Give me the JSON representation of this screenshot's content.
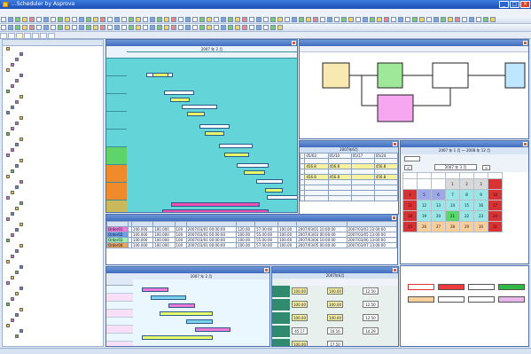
{
  "app": {
    "title": "...Scheduler by Asprova"
  },
  "menu": [
    "",
    "",
    "",
    "",
    "",
    "",
    "",
    "",
    "",
    "",
    "",
    ""
  ],
  "tabs": [
    {
      "label": ""
    },
    {
      "label": ""
    },
    {
      "label": ""
    },
    {
      "label": ""
    },
    {
      "label": ""
    },
    {
      "label": ""
    },
    {
      "label": ""
    }
  ],
  "tree": {
    "header": "",
    "nodes": [
      {
        "label": "",
        "c": "y"
      },
      {
        "label": "",
        "c": "b"
      },
      {
        "label": "",
        "c": "p"
      },
      {
        "label": "",
        "c": "p"
      },
      {
        "label": "",
        "c": "y"
      },
      {
        "label": "",
        "c": "b"
      },
      {
        "label": "",
        "c": "p"
      },
      {
        "label": "",
        "c": "p"
      },
      {
        "label": "",
        "c": "g"
      },
      {
        "label": "",
        "c": "y"
      },
      {
        "label": "",
        "c": "p"
      },
      {
        "label": "",
        "c": "b"
      },
      {
        "label": "",
        "c": "b"
      },
      {
        "label": "",
        "c": "y"
      },
      {
        "label": "",
        "c": "p"
      },
      {
        "label": "",
        "c": "p"
      },
      {
        "label": "",
        "c": "g"
      },
      {
        "label": "",
        "c": "y"
      },
      {
        "label": "",
        "c": "b"
      },
      {
        "label": "",
        "c": "p"
      },
      {
        "label": "",
        "c": "p"
      },
      {
        "label": "",
        "c": "y"
      },
      {
        "label": "",
        "c": "b"
      },
      {
        "label": "",
        "c": "g"
      },
      {
        "label": "",
        "c": "y"
      },
      {
        "label": "",
        "c": "p"
      },
      {
        "label": "",
        "c": "b"
      },
      {
        "label": "",
        "c": "y"
      },
      {
        "label": "",
        "c": "p"
      },
      {
        "label": "",
        "c": "g"
      },
      {
        "label": "",
        "c": "y"
      },
      {
        "label": "",
        "c": "b"
      },
      {
        "label": "",
        "c": "p"
      },
      {
        "label": "",
        "c": "y"
      },
      {
        "label": "",
        "c": "b"
      },
      {
        "label": "",
        "c": "p"
      },
      {
        "label": "",
        "c": "g"
      },
      {
        "label": "",
        "c": "y"
      },
      {
        "label": "",
        "c": "b"
      },
      {
        "label": "",
        "c": "p"
      },
      {
        "label": "",
        "c": "y"
      },
      {
        "label": "",
        "c": "b"
      },
      {
        "label": "",
        "c": "g"
      },
      {
        "label": "",
        "c": "y"
      },
      {
        "label": "",
        "c": "p"
      },
      {
        "label": "",
        "c": "b"
      },
      {
        "label": "",
        "c": "y"
      },
      {
        "label": "",
        "c": "p"
      },
      {
        "label": "",
        "c": "g"
      },
      {
        "label": "",
        "c": "y"
      },
      {
        "label": "",
        "c": "b"
      },
      {
        "label": "",
        "c": "p"
      },
      {
        "label": "",
        "c": "y"
      },
      {
        "label": "",
        "c": "b"
      },
      {
        "label": "",
        "c": "g"
      }
    ]
  },
  "gantt_main": {
    "title": "",
    "month": "2007 年 2 月",
    "rows": [
      {
        "label": ""
      },
      {
        "label": ""
      },
      {
        "label": ""
      },
      {
        "label": ""
      },
      {
        "label": ""
      },
      {
        "label": ""
      },
      {
        "label": ""
      },
      {
        "label": ""
      },
      {
        "label": ""
      }
    ]
  },
  "network": {
    "title": ""
  },
  "load_table": {
    "title": "",
    "month": "2007年6月",
    "dates": [
      "05/03",
      "05/10",
      "05/17",
      "05/24"
    ],
    "vals": [
      "456.8",
      "456.8",
      "",
      "456.8"
    ]
  },
  "calendar": {
    "title": "",
    "range": "2007 年 1 月 〜 2008 年 12 月",
    "month": "2007 年 3 月",
    "days": [
      "",
      "",
      "",
      "",
      "",
      "",
      ""
    ],
    "weeks": [
      [
        "",
        "",
        "",
        "1",
        "2",
        "3",
        ""
      ],
      [
        "4",
        "5",
        "6",
        "7",
        "8",
        "9",
        "10"
      ],
      [
        "11",
        "12",
        "13",
        "14",
        "15",
        "16",
        "17"
      ],
      [
        "18",
        "19",
        "20",
        "21",
        "22",
        "23",
        "24"
      ],
      [
        "25",
        "26",
        "27",
        "28",
        "29",
        "30",
        "31"
      ]
    ]
  },
  "orders": {
    "title": "",
    "cols": [
      "",
      "",
      "",
      "",
      "",
      "",
      "",
      "",
      "",
      "",
      ""
    ],
    "rows": [
      [
        "Order01",
        "",
        "100.000",
        "100.000",
        "100",
        "2007/03/01 00:00:00",
        "120.00",
        "57.00:00",
        "100.00",
        "2007/03/01 10:00:00",
        "2007/03/03 13:00:00"
      ],
      [
        "Order02",
        "",
        "100.000",
        "100.000",
        "100",
        "2007/03/01 00:00:00",
        "100.00",
        "55.00:00",
        "100.00",
        "2007/03/03 00:00:00",
        "2007/03/05 13:00:00"
      ],
      [
        "Order03",
        "",
        "100.000",
        "100.000",
        "100",
        "2007/03/01 00:00:00",
        "100.00",
        "55.00:00",
        "100.00",
        "2007/03/04 10:00:00",
        "2007/03/06 13:00:00"
      ],
      [
        "Order04",
        "",
        "100.000",
        "100.000",
        "100",
        "2007/03/01 00:00:00",
        "100.00",
        "57.00:00",
        "100.00",
        "2007/03/05 00:00:00",
        "2007/03/07 13:00:00"
      ]
    ]
  },
  "gantt_small": {
    "title": "",
    "month": "2007 年 2 月"
  },
  "resource": {
    "title": "",
    "month": "2007年6月",
    "cols": [
      "",
      "",
      "",
      "",
      "",
      ""
    ],
    "vals": [
      "100.00",
      "100.00",
      "12.50",
      "100.00",
      "100.00",
      "12.50",
      "100.00",
      "100.00",
      "12.50",
      "45.17",
      "16.16",
      "14.29",
      "100.00",
      "17.50"
    ]
  },
  "legend": {
    "buttons": [
      {
        "label": "",
        "bg": "#ffffff",
        "bd": "#d33"
      },
      {
        "label": "",
        "bg": "#ee3b3b"
      },
      {
        "label": "",
        "bg": "#ffffff"
      },
      {
        "label": "",
        "bg": "#2fb944"
      },
      {
        "label": "",
        "bg": "#f8cf9a"
      },
      {
        "label": "",
        "bg": "#ffffff"
      },
      {
        "label": "",
        "bg": "#ffffff"
      },
      {
        "label": "",
        "bg": "#e8b6e8"
      }
    ]
  },
  "statusbar": {
    "text": ""
  }
}
